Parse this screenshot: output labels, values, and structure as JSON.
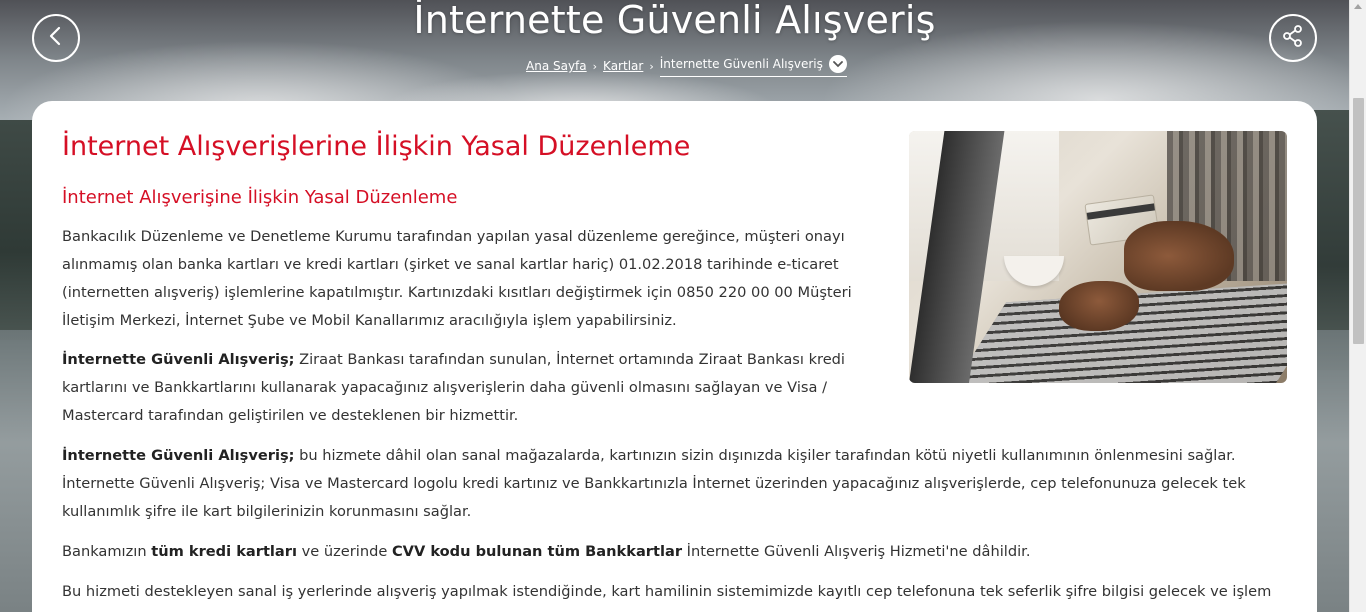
{
  "header": {
    "title": "İnternette Güvenli Alışveriş",
    "back_icon": "chevron-left-icon",
    "share_icon": "share-icon"
  },
  "breadcrumb": {
    "items": [
      "Ana Sayfa",
      "Kartlar"
    ],
    "current": "İnternette Güvenli Alışveriş"
  },
  "content": {
    "main_title": "İnternet Alışverişlerine İlişkin Yasal Düzenleme",
    "sub_title": "İnternet Alışverişine İlişkin Yasal Düzenleme",
    "p1": "Bankacılık Düzenleme ve Denetleme Kurumu tarafından yapılan yasal düzenleme gereğince, müşteri onayı alınmamış olan banka kartları ve kredi kartları (şirket ve sanal kartlar hariç) 01.02.2018 tarihinde e-ticaret (internetten alışveriş) işlemlerine kapatılmıştır. Kartınızdaki kısıtları değiştirmek için 0850 220 00 00 Müşteri İletişim Merkezi, İnternet Şube ve Mobil Kanallarımız aracılığıyla işlem yapabilirsiniz.",
    "p2_bold": "İnternette Güvenli Alışveriş;",
    "p2": " Ziraat Bankası tarafından sunulan, İnternet ortamında Ziraat Bankası kredi kartlarını ve Bankkartlarını kullanarak yapacağınız alışverişlerin daha güvenli olmasını sağlayan ve Visa / Mastercard tarafından geliştirilen ve desteklenen bir hizmettir.",
    "p3_bold": "İnternette Güvenli Alışveriş;",
    "p3": " bu hizmete dâhil olan sanal mağazalarda, kartınızın sizin dışınızda kişiler tarafından kötü niyetli kullanımının önlenmesini sağlar. İnternette Güvenli Alışveriş; Visa ve Mastercard logolu kredi kartınız ve Bankkartınızla İnternet üzerinden yapacağınız alışverişlerde, cep telefonunuza gelecek tek kullanımlık şifre ile kart bilgilerinizin korunmasını sağlar.",
    "p4_a": "Bankamızın ",
    "p4_b": "tüm kredi kartları",
    "p4_c": " ve üzerinde ",
    "p4_d": "CVV kodu bulunan tüm Bankkartlar",
    "p4_e": " İnternette Güvenli Alışveriş Hizmeti'ne dâhildir.",
    "p5": "Bu hizmeti destekleyen sanal iş yerlerinde alışveriş yapılmak istendiğinde, kart hamilinin sistemimizde kayıtlı cep telefonuna tek seferlik şifre bilgisi gelecek ve işlem bu şifre ile"
  },
  "colors": {
    "accent": "#d50f25",
    "text": "#333333"
  }
}
